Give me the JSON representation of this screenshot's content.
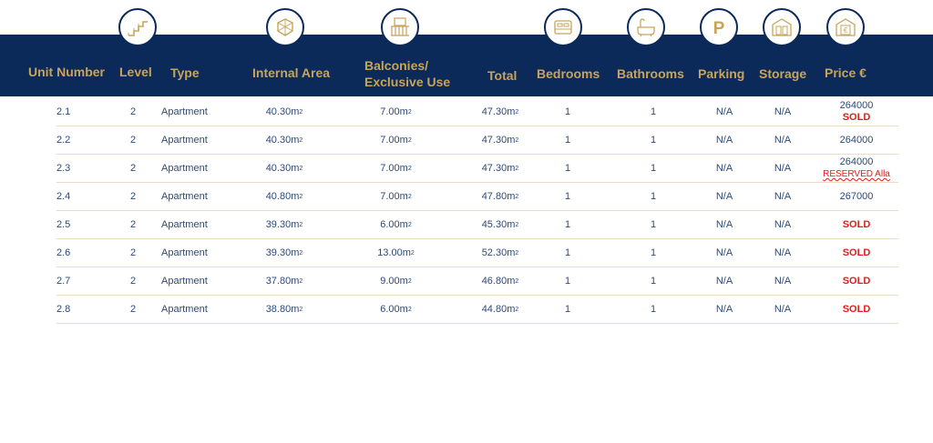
{
  "header": {
    "columns": {
      "unit_number": "Unit Number",
      "level": "Level",
      "type": "Type",
      "internal_area": "Internal Area",
      "balconies_line1": "Balconies/",
      "balconies_line2": "Exclusive Use",
      "total": "Total",
      "bedrooms": "Bedrooms",
      "bathrooms": "Bathrooms",
      "parking": "Parking",
      "storage": "Storage",
      "price": "Price €"
    },
    "icons": [
      "stairs-icon",
      "area-icon",
      "balcony-icon",
      "bed-icon",
      "bathtub-icon",
      "parking-icon",
      "storage-icon",
      "price-icon"
    ],
    "colors": {
      "band": "#0b2a5a",
      "gold": "#c9a458",
      "sold": "#e21c1c",
      "cell_text": "#2c4a7a"
    }
  },
  "unit_suffix": "m",
  "unit_sup": "2",
  "rows": [
    {
      "unit": "2.1",
      "level": "2",
      "type": "Apartment",
      "internal": "40.30",
      "balcony": "7.00",
      "total": "47.30",
      "bedrooms": "1",
      "bathrooms": "1",
      "parking": "N/A",
      "storage": "N/A",
      "price": "264000",
      "status": "SOLD",
      "note": ""
    },
    {
      "unit": "2.2",
      "level": "2",
      "type": "Apartment",
      "internal": "40.30",
      "balcony": "7.00",
      "total": "47.30",
      "bedrooms": "1",
      "bathrooms": "1",
      "parking": "N/A",
      "storage": "N/A",
      "price": "264000",
      "status": "",
      "note": ""
    },
    {
      "unit": "2.3",
      "level": "2",
      "type": "Apartment",
      "internal": "40.30",
      "balcony": "7.00",
      "total": "47.30",
      "bedrooms": "1",
      "bathrooms": "1",
      "parking": "N/A",
      "storage": "N/A",
      "price": "264000",
      "status": "",
      "note": "RESERVED Alla"
    },
    {
      "unit": "2.4",
      "level": "2",
      "type": "Apartment",
      "internal": "40.80",
      "balcony": "7.00",
      "total": "47.80",
      "bedrooms": "1",
      "bathrooms": "1",
      "parking": "N/A",
      "storage": "N/A",
      "price": "267000",
      "status": "",
      "note": ""
    },
    {
      "unit": "2.5",
      "level": "2",
      "type": "Apartment",
      "internal": "39.30",
      "balcony": "6.00",
      "total": "45.30",
      "bedrooms": "1",
      "bathrooms": "1",
      "parking": "N/A",
      "storage": "N/A",
      "price": "",
      "status": "SOLD",
      "note": ""
    },
    {
      "unit": "2.6",
      "level": "2",
      "type": "Apartment",
      "internal": "39.30",
      "balcony": "13.00",
      "total": "52.30",
      "bedrooms": "1",
      "bathrooms": "1",
      "parking": "N/A",
      "storage": "N/A",
      "price": "",
      "status": "SOLD",
      "note": ""
    },
    {
      "unit": "2.7",
      "level": "2",
      "type": "Apartment",
      "internal": "37.80",
      "balcony": "9.00",
      "total": "46.80",
      "bedrooms": "1",
      "bathrooms": "1",
      "parking": "N/A",
      "storage": "N/A",
      "price": "",
      "status": "SOLD",
      "note": ""
    },
    {
      "unit": "2.8",
      "level": "2",
      "type": "Apartment",
      "internal": "38.80",
      "balcony": "6.00",
      "total": "44.80",
      "bedrooms": "1",
      "bathrooms": "1",
      "parking": "N/A",
      "storage": "N/A",
      "price": "",
      "status": "SOLD",
      "note": ""
    }
  ]
}
